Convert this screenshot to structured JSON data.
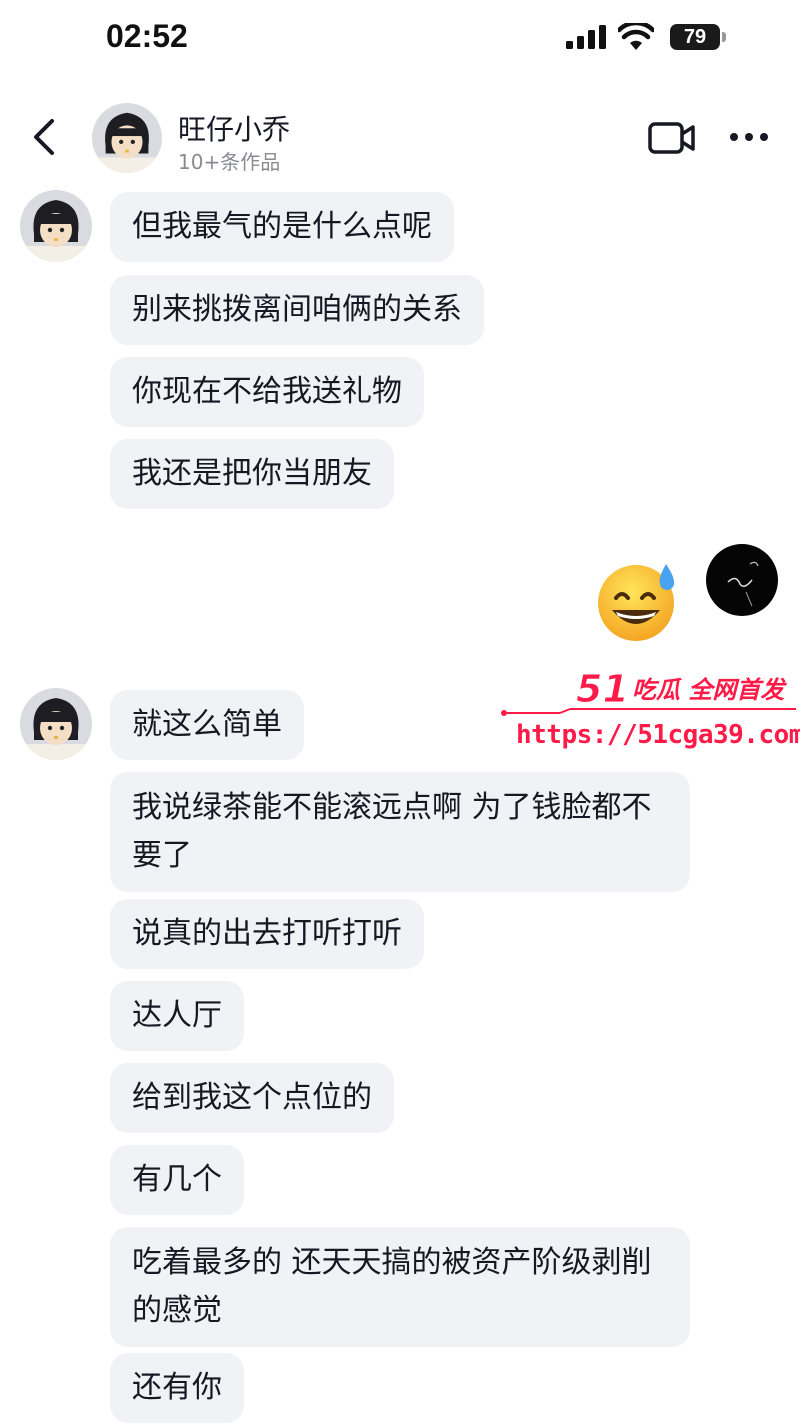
{
  "status_bar": {
    "time": "02:52",
    "battery": "79"
  },
  "header": {
    "contact_name": "旺仔小乔",
    "contact_subtitle": "10+条作品"
  },
  "messages": [
    {
      "from": "them",
      "text": "但我最气的是什么点呢"
    },
    {
      "from": "them",
      "text": "别来挑拨离间咱俩的关系"
    },
    {
      "from": "them",
      "text": "你现在不给我送礼物"
    },
    {
      "from": "them",
      "text": "我还是把你当朋友"
    },
    {
      "from": "me",
      "emoji": "😅"
    },
    {
      "from": "them",
      "text": "就这么简单"
    },
    {
      "from": "them",
      "text": "我说绿茶能不能滚远点啊 为了钱脸都不要了"
    },
    {
      "from": "them",
      "text": "说真的出去打听打听"
    },
    {
      "from": "them",
      "text": "达人厅"
    },
    {
      "from": "them",
      "text": "给到我这个点位的"
    },
    {
      "from": "them",
      "text": "有几个"
    },
    {
      "from": "them",
      "text": "吃着最多的 还天天搞的被资产阶级剥削的感觉"
    },
    {
      "from": "them",
      "text": "还有你"
    }
  ],
  "watermark": {
    "logo_number": "51",
    "logo_text": "吃瓜 全网首发",
    "url": "https://51cga39.com"
  },
  "colors": {
    "bubble_bg": "#f1f2f5",
    "text": "#161823",
    "subtext": "#8a8b91",
    "watermark": "#ff1a47"
  }
}
